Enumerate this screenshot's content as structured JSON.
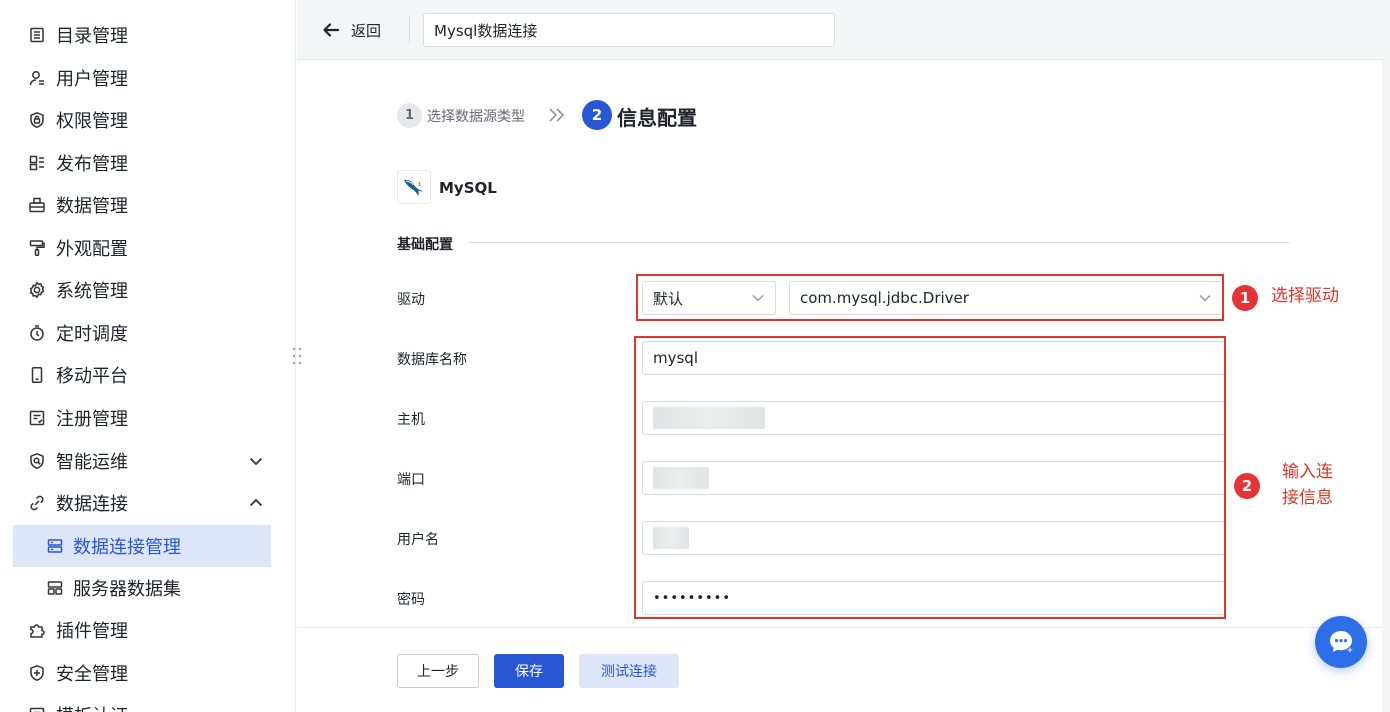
{
  "sidebar": {
    "items": [
      {
        "label": "目录管理",
        "icon": "catalog-icon"
      },
      {
        "label": "用户管理",
        "icon": "user-icon"
      },
      {
        "label": "权限管理",
        "icon": "shield-lock-icon"
      },
      {
        "label": "发布管理",
        "icon": "publish-icon"
      },
      {
        "label": "数据管理",
        "icon": "database-icon"
      },
      {
        "label": "外观配置",
        "icon": "paint-roller-icon"
      },
      {
        "label": "系统管理",
        "icon": "gear-icon"
      },
      {
        "label": "定时调度",
        "icon": "timer-icon"
      },
      {
        "label": "移动平台",
        "icon": "mobile-icon"
      },
      {
        "label": "注册管理",
        "icon": "register-icon"
      },
      {
        "label": "智能运维",
        "icon": "smart-ops-icon"
      },
      {
        "label": "数据连接",
        "icon": "link-icon"
      },
      {
        "label": "数据连接管理",
        "icon": "server-icon"
      },
      {
        "label": "服务器数据集",
        "icon": "dataset-icon"
      },
      {
        "label": "插件管理",
        "icon": "puzzle-icon"
      },
      {
        "label": "安全管理",
        "icon": "shield-plus-icon"
      },
      {
        "label": "模板认证",
        "icon": "template-icon"
      }
    ]
  },
  "topbar": {
    "back_label": "返回",
    "title_value": "Mysql数据连接"
  },
  "steps": {
    "step1_num": "1",
    "step1_label": "选择数据源类型",
    "step2_num": "2",
    "step2_label": "信息配置"
  },
  "database": {
    "name": "MySQL"
  },
  "section": {
    "title": "基础配置"
  },
  "form": {
    "driver_label": "驱动",
    "driver_mode": "默认",
    "driver_class": "com.mysql.jdbc.Driver",
    "dbname_label": "数据库名称",
    "dbname_value": "mysql",
    "host_label": "主机",
    "port_label": "端口",
    "username_label": "用户名",
    "password_label": "密码",
    "password_value": "•••••••••"
  },
  "annotations": {
    "badge1": "1",
    "note1": "选择驱动",
    "badge2": "2",
    "note2_line1": "输入连",
    "note2_line2": "接信息"
  },
  "buttons": {
    "prev": "上一步",
    "save": "保存",
    "test": "测试连接"
  },
  "colors": {
    "primary": "#2857d6",
    "annotation_red": "#e0352b",
    "active_bg": "#dde6f8"
  }
}
